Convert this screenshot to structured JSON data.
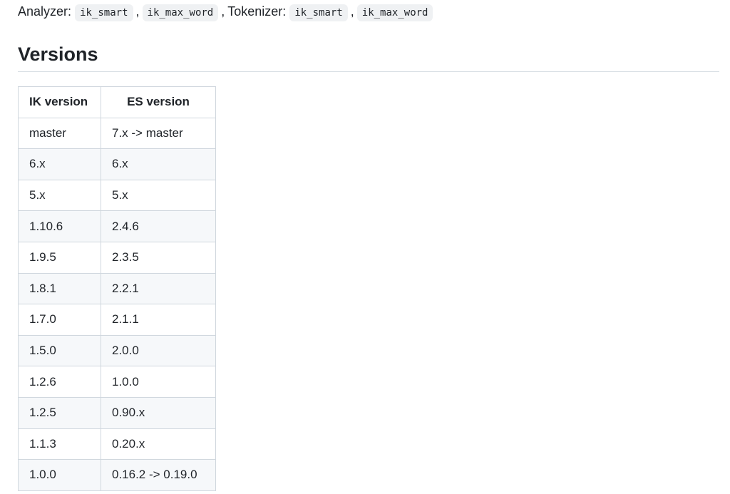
{
  "intro": {
    "analyzer_label": "Analyzer:",
    "analyzers": [
      "ik_smart",
      "ik_max_word"
    ],
    "tokenizer_label": "Tokenizer:",
    "tokenizers": [
      "ik_smart",
      "ik_max_word"
    ],
    "separator": ","
  },
  "versions": {
    "heading": "Versions",
    "headers": [
      "IK version",
      "ES version"
    ],
    "rows": [
      [
        "master",
        "7.x -> master"
      ],
      [
        "6.x",
        "6.x"
      ],
      [
        "5.x",
        "5.x"
      ],
      [
        "1.10.6",
        "2.4.6"
      ],
      [
        "1.9.5",
        "2.3.5"
      ],
      [
        "1.8.1",
        "2.2.1"
      ],
      [
        "1.7.0",
        "2.1.1"
      ],
      [
        "1.5.0",
        "2.0.0"
      ],
      [
        "1.2.6",
        "1.0.0"
      ],
      [
        "1.2.5",
        "0.90.x"
      ],
      [
        "1.1.3",
        "0.20.x"
      ],
      [
        "1.0.0",
        "0.16.2 -> 0.19.0"
      ]
    ]
  }
}
